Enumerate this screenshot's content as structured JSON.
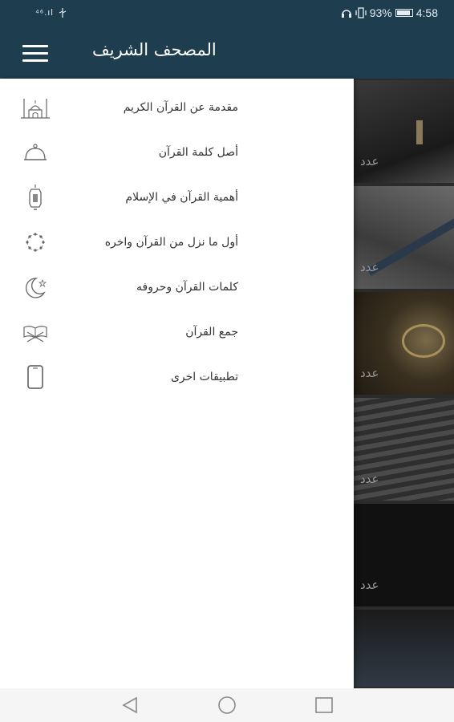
{
  "status_bar": {
    "signal_text": "⁴⁶.ıl",
    "battery_percent": "93%",
    "battery_level": 0.93,
    "time": "4:58"
  },
  "app_bar": {
    "title": "المصحف الشريف",
    "menu_icon": "hamburger-menu-icon"
  },
  "drawer": {
    "items": [
      {
        "label": "مقدمة عن القرآن الكريم",
        "icon": "mosque-icon"
      },
      {
        "label": "أصل كلمة القرآن",
        "icon": "service-bell-icon"
      },
      {
        "label": "أهمية القرآن في الإسلام",
        "icon": "lantern-icon"
      },
      {
        "label": "أول ما نزل من القرآن واخره",
        "icon": "prayer-beads-icon"
      },
      {
        "label": "كلمات القرآن وحروفه",
        "icon": "crescent-star-icon"
      },
      {
        "label": "جمع القرآن",
        "icon": "quran-stand-icon"
      },
      {
        "label": "تطبيقات اخرى",
        "icon": "phone-icon"
      }
    ]
  },
  "background_cards": [
    {
      "label": "عدد"
    },
    {
      "label": "عدد"
    },
    {
      "label": "عدد"
    },
    {
      "label": "عدد"
    },
    {
      "label": "عدد"
    }
  ],
  "nav_bar": {
    "back_icon": "back-triangle-icon",
    "home_icon": "home-circle-icon",
    "recents_icon": "recents-square-icon"
  },
  "colors": {
    "primary": "#1e3e4f",
    "drawer_background": "#ffffff",
    "text": "#333333"
  }
}
